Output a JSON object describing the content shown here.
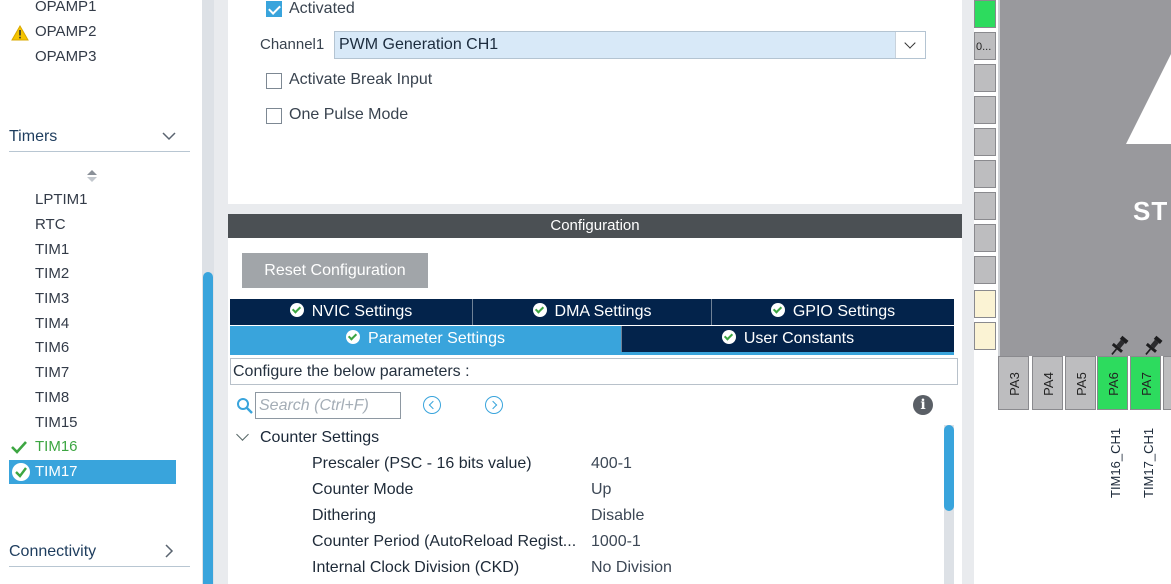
{
  "sidebar": {
    "analog_items": [
      {
        "label": "OPAMP1",
        "status": "none"
      },
      {
        "label": "OPAMP2",
        "status": "warning"
      },
      {
        "label": "OPAMP3",
        "status": "none"
      }
    ],
    "timers_section": {
      "label": "Timers"
    },
    "timer_items": [
      {
        "label": "LPTIM1",
        "status": "none"
      },
      {
        "label": "RTC",
        "status": "none"
      },
      {
        "label": "TIM1",
        "status": "none"
      },
      {
        "label": "TIM2",
        "status": "none"
      },
      {
        "label": "TIM3",
        "status": "none"
      },
      {
        "label": "TIM4",
        "status": "none"
      },
      {
        "label": "TIM6",
        "status": "none"
      },
      {
        "label": "TIM7",
        "status": "none"
      },
      {
        "label": "TIM8",
        "status": "none"
      },
      {
        "label": "TIM15",
        "status": "none"
      },
      {
        "label": "TIM16",
        "status": "configured"
      },
      {
        "label": "TIM17",
        "status": "selected"
      }
    ],
    "connectivity_section": {
      "label": "Connectivity"
    }
  },
  "mode": {
    "activated": {
      "label": "Activated",
      "checked": true
    },
    "channel1": {
      "label": "Channel1",
      "value": "PWM Generation CH1"
    },
    "break_input": {
      "label": "Activate Break Input",
      "checked": false
    },
    "one_pulse": {
      "label": "One Pulse Mode",
      "checked": false
    }
  },
  "configuration": {
    "title": "Configuration",
    "reset_button": "Reset Configuration",
    "tabs_row1": [
      {
        "label": "NVIC Settings",
        "active": false
      },
      {
        "label": "DMA Settings",
        "active": false
      },
      {
        "label": "GPIO Settings",
        "active": false
      }
    ],
    "tabs_row2": [
      {
        "label": "Parameter Settings",
        "active": true
      },
      {
        "label": "User Constants",
        "active": false
      }
    ],
    "description": "Configure the below parameters :",
    "search": {
      "placeholder": "Search (Ctrl+F)"
    },
    "group": {
      "label": "Counter Settings"
    },
    "params": [
      {
        "name": "Prescaler (PSC - 16 bits value)",
        "value": "400-1"
      },
      {
        "name": "Counter Mode",
        "value": "Up"
      },
      {
        "name": "Dithering",
        "value": "Disable"
      },
      {
        "name": "Counter Period (AutoReload Regist...",
        "value": "1000-1"
      },
      {
        "name": "Internal Clock Division (CKD)",
        "value": "No Division"
      }
    ]
  },
  "chip": {
    "brand_text": "ST",
    "left_pin_label": "0...",
    "bottom_pins": [
      {
        "label": "PA3",
        "state": "default"
      },
      {
        "label": "PA4",
        "state": "default"
      },
      {
        "label": "PA5",
        "state": "default"
      },
      {
        "label": "PA6",
        "state": "assigned"
      },
      {
        "label": "PA7",
        "state": "assigned"
      }
    ],
    "signal_labels": [
      "TIM16_CH1",
      "TIM17_CH1"
    ]
  },
  "colors": {
    "accent": "#39a4dc",
    "tab_dark": "#03234b",
    "header_dark": "#4b5054",
    "ok_green": "#3da642",
    "pin_green": "#2ddb5e",
    "warning_yellow": "#f5c400"
  }
}
